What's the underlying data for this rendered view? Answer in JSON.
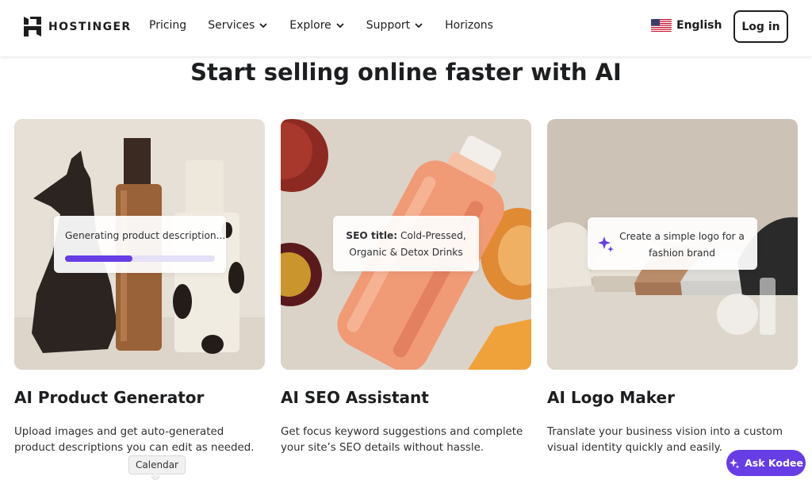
{
  "header": {
    "brand": "HOSTINGER",
    "nav": [
      {
        "label": "Pricing",
        "dropdown": false
      },
      {
        "label": "Services",
        "dropdown": true
      },
      {
        "label": "Explore",
        "dropdown": true
      },
      {
        "label": "Support",
        "dropdown": true
      },
      {
        "label": "Horizons",
        "dropdown": false
      }
    ],
    "language": "English",
    "login_label": "Log in"
  },
  "section": {
    "title": "Start selling online faster with AI"
  },
  "cards": [
    {
      "title": "AI Product Generator",
      "description": "Upload images and get auto-generated product descriptions you can edit as needed.",
      "overlay_text": "Generating product description...",
      "progress": 0.45
    },
    {
      "title": "AI SEO Assistant",
      "description": "Get focus keyword suggestions and complete your site’s SEO details without hassle.",
      "overlay_label": "SEO title:",
      "overlay_text": "Cold-Pressed, Organic & Detox Drinks"
    },
    {
      "title": "AI Logo Maker",
      "description": "Translate your business vision into a custom visual identity quickly and easily.",
      "overlay_text": "Create a simple logo for a fashion brand"
    }
  ],
  "tooltip": "Calendar",
  "chat_button": "Ask Kodee",
  "colors": {
    "accent": "#673de6",
    "text": "#1d1e20"
  }
}
